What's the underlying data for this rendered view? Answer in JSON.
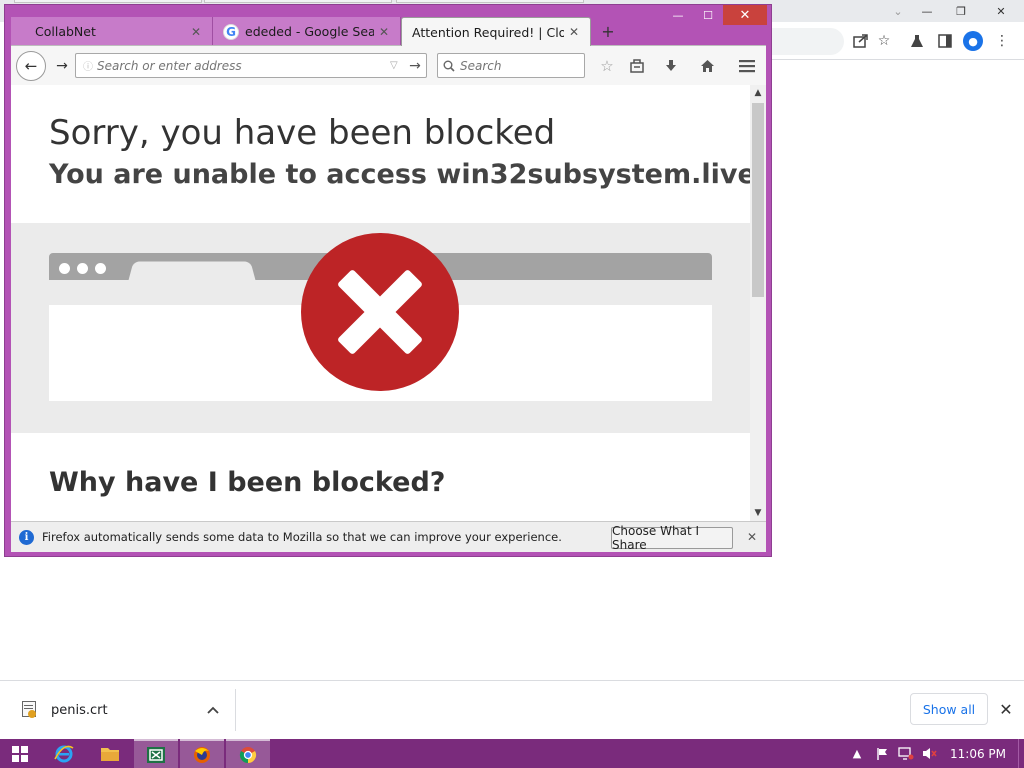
{
  "colors": {
    "firefox_frame": "#b353b5",
    "taskbar": "#7a2b7c",
    "error_red": "#bd2426",
    "link_blue": "#1a73e8"
  },
  "chrome_window": {
    "toolbar_icons": [
      "share-icon",
      "star-icon",
      "labs-flask-icon",
      "side-panel-icon",
      "profile-avatar-icon",
      "kebab-menu-icon"
    ],
    "download_bar": {
      "file_name": "penis.crt",
      "show_all_label": "Show all"
    }
  },
  "firefox_window": {
    "tabs": [
      {
        "label": "CollabNet",
        "icon": "none"
      },
      {
        "label": "ededed - Google Search",
        "icon": "google-icon"
      },
      {
        "label": "Attention Required! | Clou...",
        "icon": "none",
        "active": true
      }
    ],
    "navbar": {
      "url_placeholder": "Search or enter address",
      "search_placeholder": "Search"
    },
    "page": {
      "title": "Sorry, you have been blocked",
      "subtitle": "You are unable to access win32subsystem.live",
      "section_heading": "Why have I been blocked?"
    },
    "notification": {
      "text": "Firefox automatically sends some data to Mozilla so that we can improve your experience.",
      "button_label": "Choose What I Share"
    }
  },
  "taskbar": {
    "apps": [
      "start-button",
      "internet-explorer-icon",
      "file-explorer-icon",
      "excel-icon",
      "firefox-icon",
      "chrome-icon"
    ],
    "clock": "11:06 PM"
  }
}
